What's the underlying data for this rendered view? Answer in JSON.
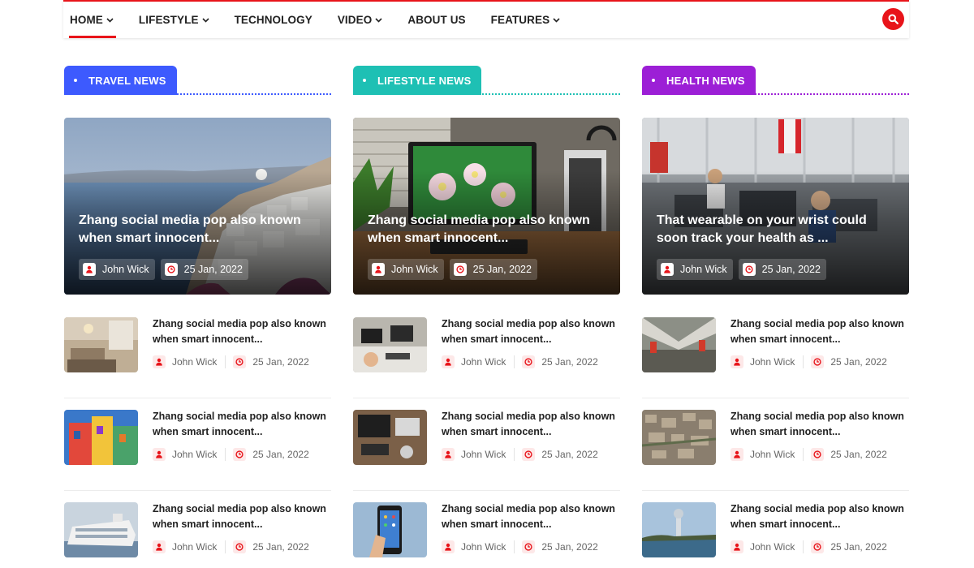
{
  "nav": {
    "items": [
      {
        "label": "HOME",
        "dropdown": true,
        "active": true
      },
      {
        "label": "LIFESTYLE",
        "dropdown": true,
        "active": false
      },
      {
        "label": "TECHNOLOGY",
        "dropdown": false,
        "active": false
      },
      {
        "label": "VIDEO",
        "dropdown": true,
        "active": false
      },
      {
        "label": "ABOUT US",
        "dropdown": false,
        "active": false
      },
      {
        "label": "FEATURES",
        "dropdown": true,
        "active": false
      }
    ],
    "search_icon": "search-icon"
  },
  "colors": {
    "accent": "#e8141a",
    "travel": "#3d5afe",
    "lifestyle": "#1ec0b4",
    "health": "#9c1fd6"
  },
  "columns": [
    {
      "category": "TRAVEL NEWS",
      "feature": {
        "title": "Zhang social media pop also known when smart innocent...",
        "author": "John Wick",
        "date": "25 Jan, 2022"
      },
      "items": [
        {
          "title": "Zhang social media pop also known when smart innocent...",
          "author": "John Wick",
          "date": "25 Jan, 2022"
        },
        {
          "title": "Zhang social media pop also known when smart innocent...",
          "author": "John Wick",
          "date": "25 Jan, 2022"
        },
        {
          "title": "Zhang social media pop also known when smart innocent...",
          "author": "John Wick",
          "date": "25 Jan, 2022"
        }
      ]
    },
    {
      "category": "LIFESTYLE NEWS",
      "feature": {
        "title": "Zhang social media pop also known when smart innocent...",
        "author": "John Wick",
        "date": "25 Jan, 2022"
      },
      "items": [
        {
          "title": "Zhang social media pop also known when smart innocent...",
          "author": "John Wick",
          "date": "25 Jan, 2022"
        },
        {
          "title": "Zhang social media pop also known when smart innocent...",
          "author": "John Wick",
          "date": "25 Jan, 2022"
        },
        {
          "title": "Zhang social media pop also known when smart innocent...",
          "author": "John Wick",
          "date": "25 Jan, 2022"
        }
      ]
    },
    {
      "category": "HEALTH NEWS",
      "feature": {
        "title": "That wearable on your wrist could soon track your health as ...",
        "author": "John Wick",
        "date": "25 Jan, 2022"
      },
      "items": [
        {
          "title": "Zhang social media pop also known when smart innocent...",
          "author": "John Wick",
          "date": "25 Jan, 2022"
        },
        {
          "title": "Zhang social media pop also known when smart innocent...",
          "author": "John Wick",
          "date": "25 Jan, 2022"
        },
        {
          "title": "Zhang social media pop also known when smart innocent...",
          "author": "John Wick",
          "date": "25 Jan, 2022"
        }
      ]
    }
  ]
}
